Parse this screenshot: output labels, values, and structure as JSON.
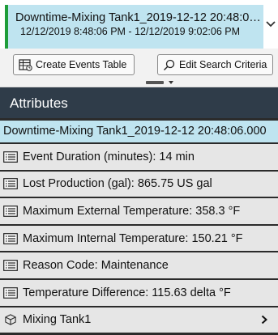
{
  "event": {
    "title": "Downtime-Mixing Tank1_2019-12-12 20:48:06.000",
    "time_range": "12/12/2019 8:48:06 PM - 12/12/2019 9:02:06 PM",
    "status_color": "#1f9d3a"
  },
  "toolbar": {
    "create_events_table_label": "Create Events Table",
    "edit_search_criteria_label": "Edit Search Criteria"
  },
  "attributes": {
    "title": "Attributes",
    "event_name": "Downtime-Mixing Tank1_2019-12-12 20:48:06.000",
    "items": [
      {
        "label": "Event Duration (minutes): 14 min",
        "icon": "list-icon"
      },
      {
        "label": "Lost Production (gal): 865.75 US gal",
        "icon": "list-icon"
      },
      {
        "label": "Maximum External Temperature: 358.3 °F",
        "icon": "list-icon"
      },
      {
        "label": "Maximum Internal Temperature: 150.21 °F",
        "icon": "list-icon"
      },
      {
        "label": "Reason Code: Maintenance",
        "icon": "list-icon"
      },
      {
        "label": "Temperature Difference: 115.63 delta °F",
        "icon": "list-icon"
      }
    ],
    "parent": {
      "label": "Mixing Tank1",
      "icon": "cube-icon"
    }
  },
  "colors": {
    "selection": "#bfe4f0",
    "panel_header": "#2f3c49",
    "row_background": "#e6e6e6"
  }
}
